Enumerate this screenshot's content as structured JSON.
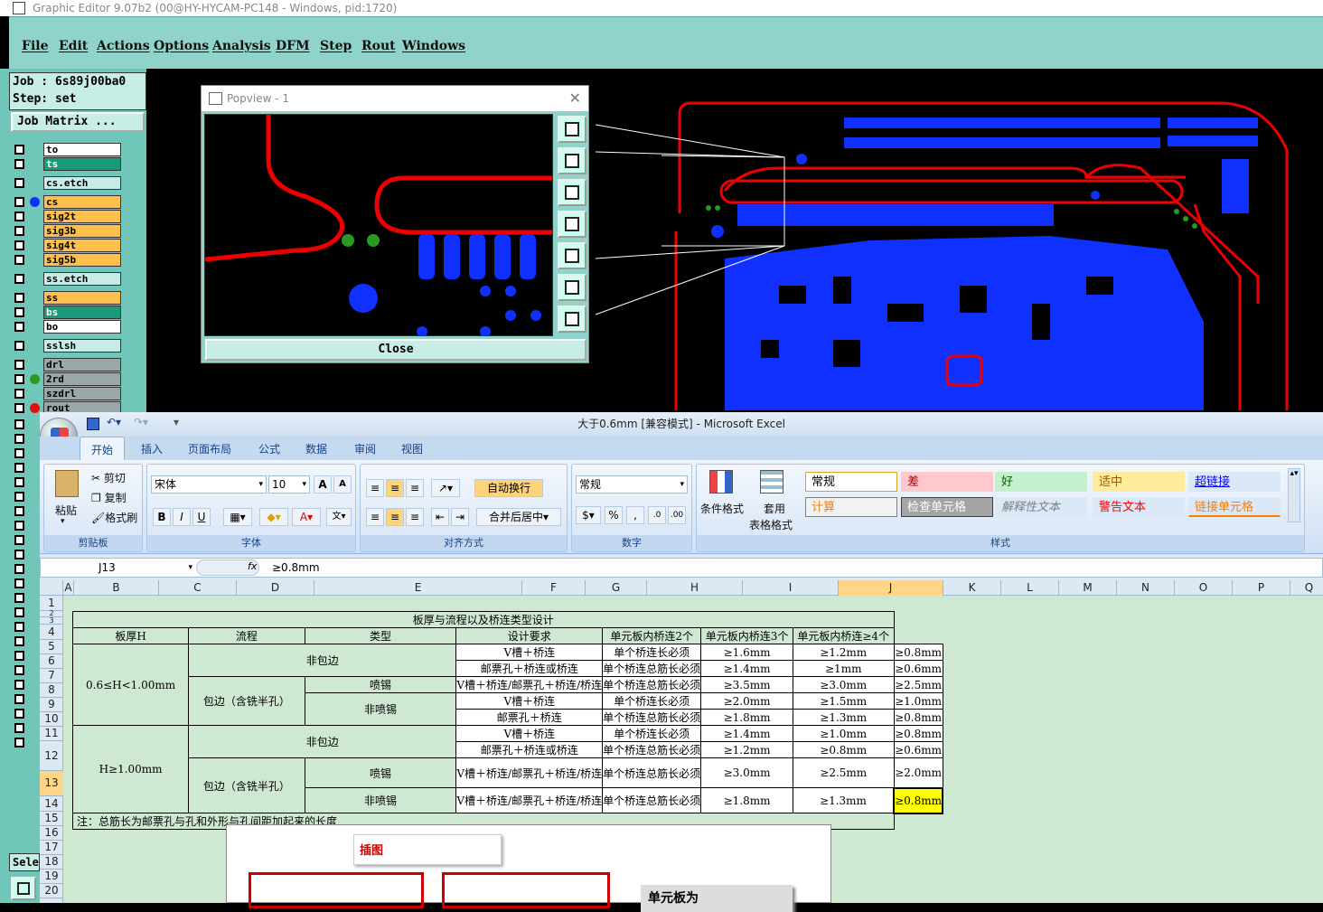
{
  "cam": {
    "title": "Graphic Editor 9.07b2 (00@HY-HYCAM-PC148 - Windows, pid:1720)",
    "menu": [
      "File",
      "Edit",
      "Actions",
      "Options",
      "Analysis",
      "DFM",
      "Step",
      "Rout",
      "Windows"
    ],
    "job": "Job : 6s89j00ba0",
    "step": "Step: set",
    "job_matrix": "Job Matrix ...",
    "layers": [
      {
        "name": "to",
        "color": "#ffffff",
        "dot": ""
      },
      {
        "name": "ts",
        "color": "#1a9a78",
        "dot": ""
      },
      {
        "name": "cs.etch",
        "color": "#c8ece6",
        "dot": ""
      },
      {
        "name": "cs",
        "color": "#ffc04d",
        "dot": "#1030ff"
      },
      {
        "name": "sig2t",
        "color": "#ffc04d",
        "dot": ""
      },
      {
        "name": "sig3b",
        "color": "#ffc04d",
        "dot": ""
      },
      {
        "name": "sig4t",
        "color": "#ffc04d",
        "dot": ""
      },
      {
        "name": "sig5b",
        "color": "#ffc04d",
        "dot": ""
      },
      {
        "name": "ss.etch",
        "color": "#c8ece6",
        "dot": ""
      },
      {
        "name": "ss",
        "color": "#ffc04d",
        "dot": ""
      },
      {
        "name": "bs",
        "color": "#1a9a78",
        "dot": ""
      },
      {
        "name": "bo",
        "color": "#ffffff",
        "dot": ""
      },
      {
        "name": "sslsh",
        "color": "#c8ece6",
        "dot": ""
      },
      {
        "name": "drl",
        "color": "#9aa7a8",
        "dot": ""
      },
      {
        "name": "2rd",
        "color": "#9aa7a8",
        "dot": "#2a9a20"
      },
      {
        "name": "szdrl",
        "color": "#9aa7a8",
        "dot": ""
      },
      {
        "name": "rout",
        "color": "#9aa7a8",
        "dot": "#e01010"
      }
    ],
    "sele_label": "Sele",
    "popview": {
      "title": "Popview - 1",
      "close": "Close"
    }
  },
  "excel": {
    "title": "大于0.6mm  [兼容模式] - Microsoft Excel",
    "tabs": [
      "开始",
      "插入",
      "页面布局",
      "公式",
      "数据",
      "审阅",
      "视图"
    ],
    "clipboard": {
      "paste": "粘贴",
      "cut": "剪切",
      "copy": "复制",
      "format": "格式刷",
      "label": "剪贴板"
    },
    "font": {
      "name": "宋体",
      "size": "10",
      "label": "字体"
    },
    "align": {
      "wrap": "自动换行",
      "merge": "合并后居中",
      "label": "对齐方式"
    },
    "number": {
      "format": "常规",
      "label": "数字"
    },
    "styles": {
      "cond": "条件格式",
      "table_fmt": "套用",
      "table_fmt2": "表格格式",
      "label": "样式",
      "items": [
        {
          "t": "常规",
          "bg": "#ffffff",
          "fg": "#000",
          "bd": "#e0a020"
        },
        {
          "t": "差",
          "bg": "#ffc7ce",
          "fg": "#9c0006",
          "bd": "#ffc7ce"
        },
        {
          "t": "好",
          "bg": "#c6efce",
          "fg": "#006100",
          "bd": "#c6efce"
        },
        {
          "t": "适中",
          "bg": "#ffeb9c",
          "fg": "#9c5700",
          "bd": "#ffeb9c"
        },
        {
          "t": "超链接",
          "bg": "#dbe8f7",
          "fg": "#0000ff",
          "bd": "#dbe8f7"
        },
        {
          "t": "计算",
          "bg": "#f2f2f2",
          "fg": "#fa7d00",
          "bd": "#7f7f7f"
        },
        {
          "t": "检查单元格",
          "bg": "#a5a5a5",
          "fg": "#fff",
          "bd": "#3f3f3f"
        },
        {
          "t": "解释性文本",
          "bg": "#dbe8f7",
          "fg": "#7f7f7f",
          "bd": "#dbe8f7"
        },
        {
          "t": "警告文本",
          "bg": "#dbe8f7",
          "fg": "#ff0000",
          "bd": "#dbe8f7"
        },
        {
          "t": "链接单元格",
          "bg": "#dbe8f7",
          "fg": "#fa7d00",
          "bd": "#dbe8f7"
        }
      ]
    },
    "namebox": "J13",
    "formula": "≥0.8mm",
    "cols": [
      "A",
      "B",
      "C",
      "D",
      "E",
      "F",
      "G",
      "H",
      "I",
      "J",
      "K",
      "L",
      "M",
      "N",
      "O",
      "P",
      "Q"
    ],
    "rows": [
      "1",
      "2",
      "3",
      "4",
      "5",
      "6",
      "7",
      "8",
      "9",
      "10",
      "11",
      "12",
      "13",
      "14",
      "15",
      "16",
      "17",
      "18",
      "19",
      "20"
    ],
    "table": {
      "title": "板厚与流程以及桥连类型设计",
      "headers": [
        "板厚H",
        "流程",
        "类型",
        "设计要求",
        "单元板内桥连2个",
        "单元板内桥连3个",
        "单元板内桥连≥4个"
      ],
      "g1": "0.6≤H<1.00mm",
      "g2": "H≥1.00mm",
      "nowrap": "非包边",
      "wrap": "包边（含铣半孔）",
      "spray": "喷锡",
      "nospray": "非喷锡",
      "rows": [
        [
          "V槽＋桥连",
          "单个桥连长必须",
          "≥1.6mm",
          "≥1.2mm",
          "≥0.8mm"
        ],
        [
          "邮票孔＋桥连或桥连",
          "单个桥连总筋长必须",
          "≥1.4mm",
          "≥1mm",
          "≥0.6mm"
        ],
        [
          "V槽＋桥连/邮票孔＋桥连/桥连",
          "单个桥连总筋长必须",
          "≥3.5mm",
          "≥3.0mm",
          "≥2.5mm"
        ],
        [
          "V槽＋桥连",
          "单个桥连长必须",
          "≥2.0mm",
          "≥1.5mm",
          "≥1.0mm"
        ],
        [
          "邮票孔＋桥连",
          "单个桥连总筋长必须",
          "≥1.8mm",
          "≥1.3mm",
          "≥0.8mm"
        ],
        [
          "V槽＋桥连",
          "单个桥连长必须",
          "≥1.4mm",
          "≥1.0mm",
          "≥0.8mm"
        ],
        [
          "邮票孔＋桥连或桥连",
          "单个桥连总筋长必须",
          "≥1.2mm",
          "≥0.8mm",
          "≥0.6mm"
        ],
        [
          "V槽＋桥连/邮票孔＋桥连/桥连",
          "单个桥连总筋长必须",
          "≥3.0mm",
          "≥2.5mm",
          "≥2.0mm"
        ],
        [
          "V槽＋桥连/邮票孔＋桥连/桥连",
          "单个桥连总筋长必须",
          "≥1.8mm",
          "≥1.3mm",
          "≥0.8mm"
        ]
      ],
      "note": "注：总筋长为邮票孔与孔和外形与孔间距加起来的长度"
    },
    "insert_label": "插图",
    "unit_label": "单元板为"
  }
}
